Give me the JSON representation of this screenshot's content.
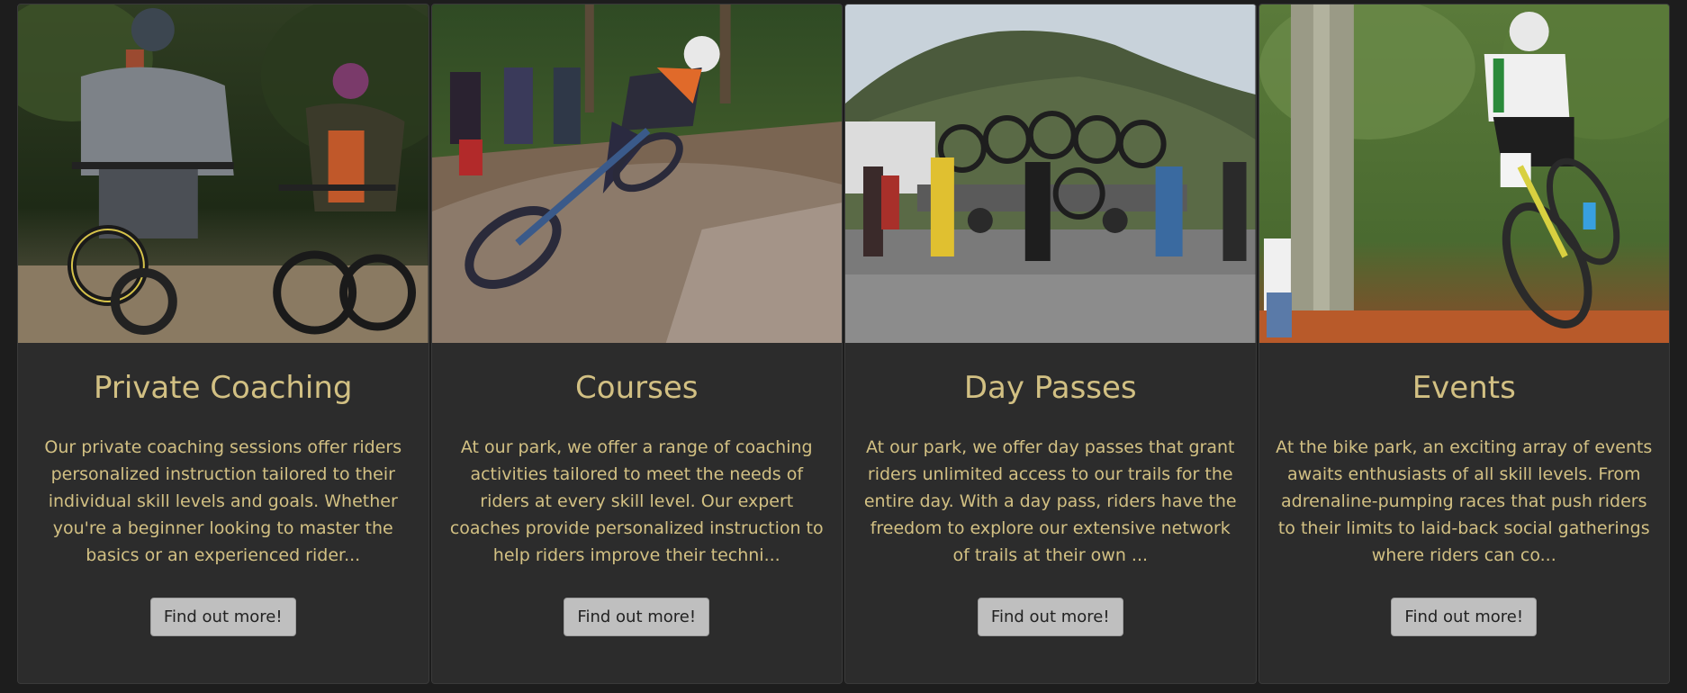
{
  "cards": [
    {
      "title": "Private Coaching",
      "text": "Our private coaching sessions offer riders personalized instruction tailored to their individual skill levels and goals. Whether you're a beginner looking to master the basics or an experienced rider...",
      "button": "Find out more!",
      "image_icon": "photo-two-riders-on-trail"
    },
    {
      "title": "Courses",
      "text": "At our park, we offer a range of coaching activities tailored to meet the needs of riders at every skill level. Our expert coaches provide personalized instruction to help riders improve their techni...",
      "button": "Find out more!",
      "image_icon": "photo-rider-cornering-berm"
    },
    {
      "title": "Day Passes",
      "text": "At our park, we offer day passes that grant riders unlimited access to our trails for the entire day. With a day pass, riders have the freedom to explore our extensive network of trails at their own ...",
      "button": "Find out more!",
      "image_icon": "photo-bike-trailer-mountain"
    },
    {
      "title": "Events",
      "text": "At the bike park, an exciting array of events awaits enthusiasts of all skill levels. From adrenaline-pumping races that push riders to their limits to laid-back social gatherings where riders can co...",
      "button": "Find out more!",
      "image_icon": "photo-race-rider-forest"
    }
  ],
  "colors": {
    "page_background": "#1d1d1d",
    "card_background": "#2c2c2c",
    "heading_text": "#d2c083",
    "button_background": "#bfbfbf"
  }
}
